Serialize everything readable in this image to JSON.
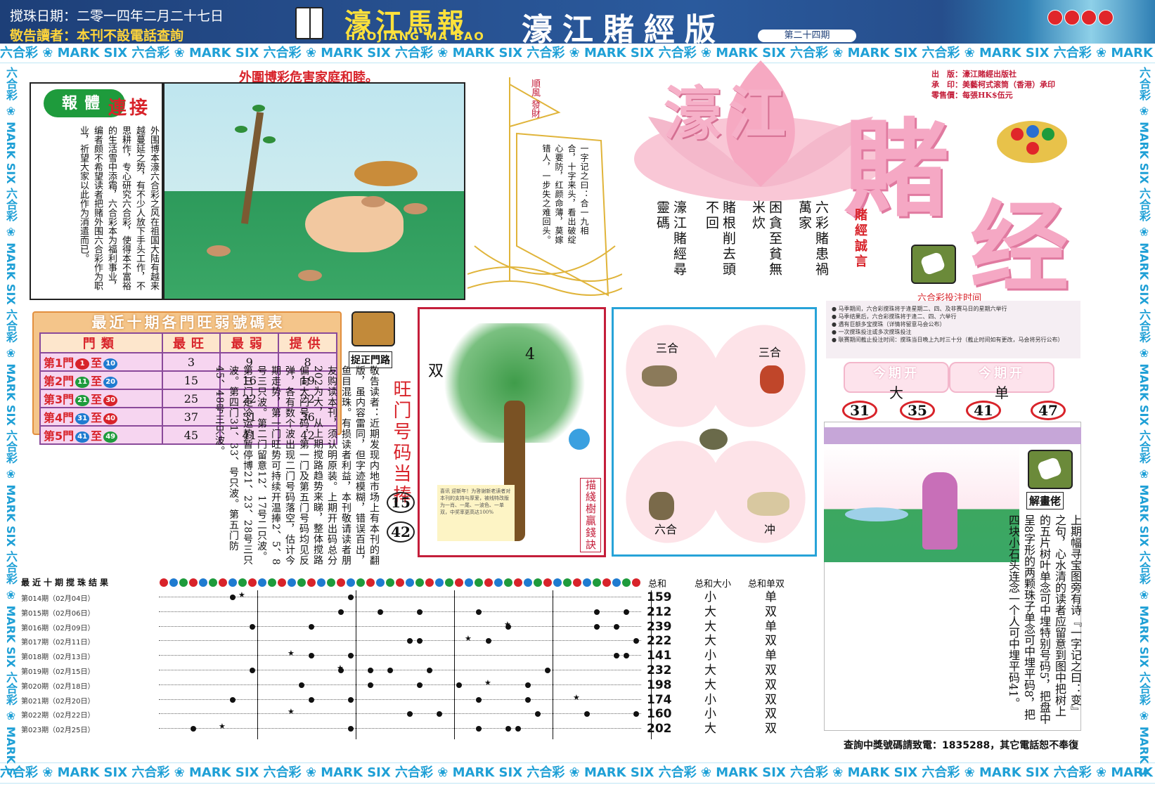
{
  "header": {
    "date": "搅珠日期：二零一四年二月二十七日",
    "notice": "敬告讀者：本刊不設電話查詢",
    "masthead_cn": "濠江馬報",
    "masthead_en": "HAOJIANG MA BAO",
    "edition": "濠江賭經版",
    "issue": "第二十四期"
  },
  "band_text": "六合彩 ❀ MARK SIX 六合彩 ❀ MARK SIX 六合彩 ❀ MARK SIX 六合彩 ❀ MARK SIX 六合彩 ❀ MARK SIX 六合彩 ❀ MARK SIX 六合彩 ❀ MARK SIX 六合彩 ❀ MARK SIX 六合彩 ❀ MARK SIX 六合彩 ❀ MARK SIX",
  "section1": {
    "title": "外圍博彩危害家庭和睦。",
    "badge": "報體",
    "badge2": "連接",
    "body": "外围博本濠六合彩之风在祖国大陆有越来越蔓延之势，有不少人放下手头工作，不思耕作，专心研究六合彩，使得本不富裕的生活雪中添霜，六合彩本为福利事业，编者颇不希望读者把赌外围六合彩作为职业，祈望大家以此作为消遣而已。"
  },
  "boat": {
    "flag": "順風 發財",
    "poem": "一字记之曰：合一九相合，十字来头，看出破绽心要防，红颜命薄，莫嫁错人，一步失之难回头。"
  },
  "masthead_big": {
    "a": "濠江",
    "b": "賭",
    "c": "经"
  },
  "publisher": {
    "l1": "出　版：濠江賭經出版社",
    "l2": "承　印：美藝柯式滚筒（香港）承印",
    "l3": "零售價：每張HK$伍元"
  },
  "motto": {
    "title": "賭經誠言",
    "cols": [
      "六彩賭患禍萬家",
      "困貪至貧無米炊",
      "賭根削去頭不回",
      "濠江賭經尋靈碼"
    ]
  },
  "bettime": {
    "title": "六合彩投注时间",
    "lines": [
      "● 马季期间，六合彩搅珠将于逢星期二、四、及非赛马日的星期六举行",
      "● 马季结果后，六合彩搅珠将于逢二、四、六举行",
      "● 遇有巨额多宝搅珠（详情将留意马会公布）",
      "● 一次搅珠投注或多次搅珠投注",
      "● 联赛期间截止投注时间：搅珠当日晚上九时三十分（截止时间如有更改，马会将另行公布）"
    ]
  },
  "this_period": {
    "label": "今期开",
    "big": "大",
    "single": "单",
    "balls": [
      "31",
      "35",
      "41",
      "47"
    ]
  },
  "gate_table": {
    "title": "最近十期各門旺弱號碼表",
    "headers": [
      "門類",
      "最旺",
      "最弱",
      "提供"
    ],
    "rows": [
      {
        "gate": "第1門",
        "from": "1",
        "to": "10",
        "c1": "#d8232a",
        "c2": "#1f7bd0",
        "max": "3",
        "min": "9",
        "tip": "8"
      },
      {
        "gate": "第2門",
        "from": "11",
        "to": "20",
        "c1": "#1e9b3c",
        "c2": "#1f7bd0",
        "max": "15",
        "min": "16",
        "tip": "19"
      },
      {
        "gate": "第3門",
        "from": "21",
        "to": "30",
        "c1": "#1e9b3c",
        "c2": "#d8232a",
        "max": "25",
        "min": "22",
        "tip": "22"
      },
      {
        "gate": "第4門",
        "from": "31",
        "to": "40",
        "c1": "#1f7bd0",
        "c2": "#d8232a",
        "max": "37",
        "min": "31",
        "tip": "36"
      },
      {
        "gate": "第5門",
        "from": "41",
        "to": "49",
        "c1": "#1f7bd0",
        "c2": "#1e9b3c",
        "max": "45",
        "min": "41",
        "tip": "42"
      }
    ],
    "to_word": "至"
  },
  "gate_route": {
    "label": "捉正門路",
    "title": "旺门号码当捧",
    "nums": [
      "15",
      "42"
    ],
    "text": "敬告读者：近期发现内地市场上有本刊的翻版，虽内容雷同，但字迹模糊，错误百出，鱼目混珠。有损读者利益，本刊敬请读者朋友购读本刊，须认明原装。上期开出码总分202为大，从上期搅路趋势来睇，整体搅路偏向大门号码，第一门及第五门号码均见反弹，各有数个波出现二门号码落空，估计今期走势，第一门旺势可持续开温捧2、5、8号三只波。第二门留意12、17号二只波。第三门走冷运势暂停博21、23、28号三只波。第四门31、33、号只波。第五门防45、48号三只波。"
  },
  "tree": {
    "shuang": "双",
    "four": "4",
    "sidebar": "描綫樹贏錢訣",
    "note": "喜讯 迎新年！为答谢新老读者对本刊的支持与厚爱，被线特改版为一肖、一尾、一波色、一单双，中奖率更高达100%"
  },
  "zodiac": {
    "top_left": "三合",
    "top_right": "三合",
    "bottom_left": "六合",
    "bottom_right": "冲"
  },
  "results": {
    "title": "最近十期搅珠结果",
    "rows": [
      {
        "issue": "第014期（02月04日）",
        "dots": [
          8,
          20
        ],
        "stars": [
          9
        ]
      },
      {
        "issue": "第015期（02月06日）",
        "dots": [
          19,
          23,
          27,
          33,
          45,
          48
        ],
        "stars": []
      },
      {
        "issue": "第016期（02月09日）",
        "dots": [
          10,
          16,
          36,
          45,
          47
        ],
        "stars": [
          36
        ]
      },
      {
        "issue": "第017期（02月11日）",
        "dots": [
          26,
          27,
          34,
          49
        ],
        "stars": [
          32
        ]
      },
      {
        "issue": "第018期（02月13日）",
        "dots": [
          16,
          20,
          47,
          48
        ],
        "stars": [
          14
        ]
      },
      {
        "issue": "第019期（02月15日）",
        "dots": [
          10,
          19,
          22,
          24,
          28,
          40
        ],
        "stars": [
          19
        ]
      },
      {
        "issue": "第020期（02月18日）",
        "dots": [
          15,
          22,
          27,
          31,
          38
        ],
        "stars": [
          34
        ]
      },
      {
        "issue": "第021期（02月20日）",
        "dots": [
          8,
          16,
          20,
          33,
          38
        ],
        "stars": [
          43
        ]
      },
      {
        "issue": "第022期（02月22日）",
        "dots": [
          26,
          29,
          39,
          44,
          49
        ],
        "stars": [
          14
        ]
      },
      {
        "issue": "第023期（02月25日）",
        "dots": [
          4,
          20,
          33,
          36,
          37
        ],
        "stars": [
          7
        ]
      }
    ]
  },
  "sums": {
    "h1": "总和",
    "h2": "总和大小",
    "h3": "总和单双",
    "totals": [
      "159",
      "212",
      "239",
      "222",
      "141",
      "232",
      "198",
      "174",
      "160",
      "202"
    ],
    "size": [
      "小",
      "大",
      "大",
      "大",
      "小",
      "大",
      "大",
      "小",
      "小",
      "大"
    ],
    "parity": [
      "单",
      "双",
      "单",
      "双",
      "单",
      "双",
      "双",
      "双",
      "双",
      "双"
    ]
  },
  "solve": {
    "label": "解畫佬",
    "text": "上期幅寻宝图旁有诗『一字记之曰：变』之句，心水清的读者应留意到图中把树上的五片树叶单念可中埋特别号码5，把盘中呈8字形的两颗珠子单念可中埋平码8，把四块小石头连念一个人可中埋平码41。"
  },
  "footer": "查詢中獎號碼請致電：1835288，其它電話恕不奉復"
}
